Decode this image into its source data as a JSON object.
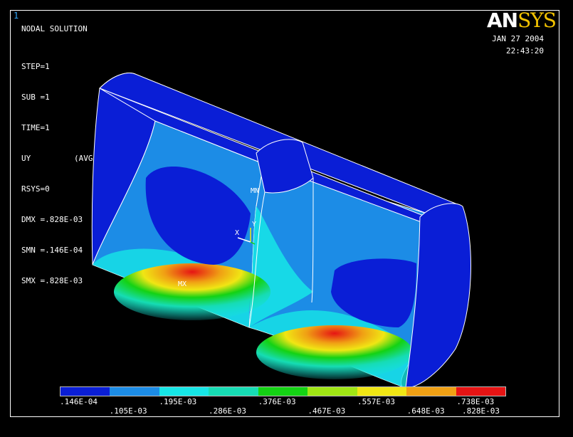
{
  "window": {
    "number": "1"
  },
  "plot": {
    "title": "NODAL SOLUTION",
    "info_lines": [
      "STEP=1",
      "SUB =1",
      "TIME=1",
      "UY",
      "RSYS=0",
      "DMX =.828E-03",
      "SMN =.146E-04",
      "SMX =.828E-03"
    ],
    "avg_tag": "(AVG)"
  },
  "logo": {
    "an": "AN",
    "sys": "SYS"
  },
  "timestamp": {
    "date": "JAN 27 2004",
    "time": "22:43:20"
  },
  "markers": {
    "mn": "MN",
    "mx": "MX",
    "axis_x": "X",
    "axis_y": "Y"
  },
  "legend": {
    "colors": [
      "#0a1ed6",
      "#1c8ce6",
      "#16e6e6",
      "#16dcb4",
      "#14d214",
      "#a0e614",
      "#f0e614",
      "#f0a014",
      "#e61414"
    ],
    "labels_lower": [
      ".146E-04",
      ".195E-03",
      ".376E-03",
      ".557E-03",
      ".738E-03"
    ],
    "labels_upper": [
      ".105E-03",
      ".286E-03",
      ".467E-03",
      ".648E-03",
      ".828E-03"
    ]
  },
  "colors": {
    "background": "#000000",
    "frame": "#ffffff",
    "window_number": "#33aaff",
    "logo_sys": "#f2c200"
  }
}
